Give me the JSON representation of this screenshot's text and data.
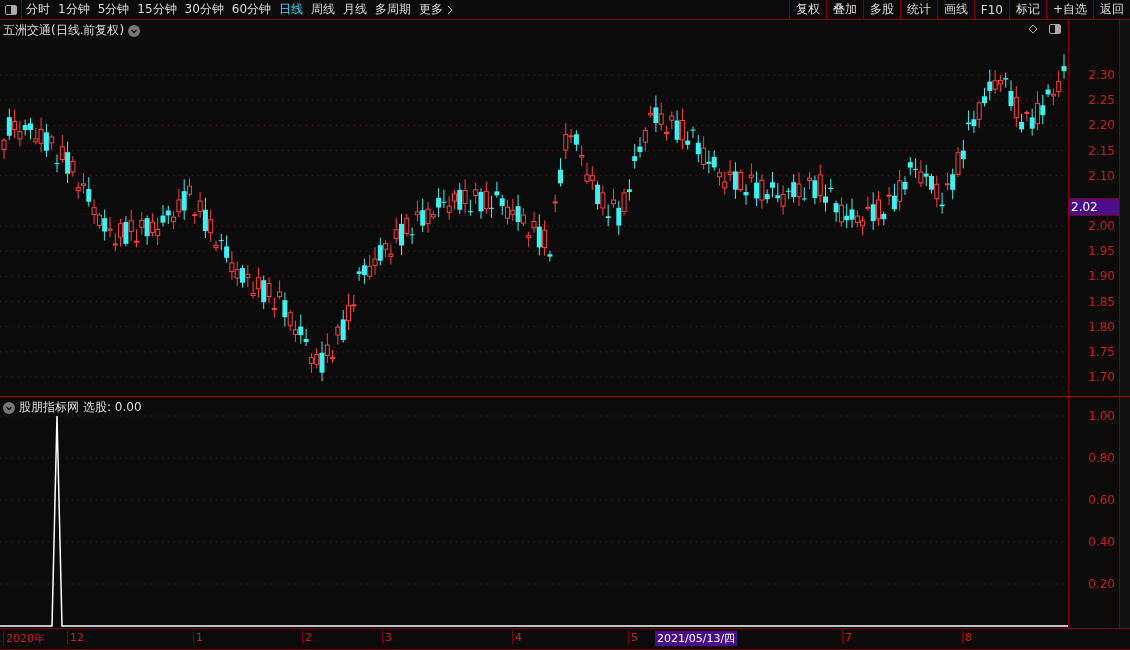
{
  "toolbar": {
    "periods": [
      {
        "label": "分时",
        "selected": false
      },
      {
        "label": "1分钟",
        "selected": false
      },
      {
        "label": "5分钟",
        "selected": false
      },
      {
        "label": "15分钟",
        "selected": false
      },
      {
        "label": "30分钟",
        "selected": false
      },
      {
        "label": "60分钟",
        "selected": false
      },
      {
        "label": "日线",
        "selected": true
      },
      {
        "label": "周线",
        "selected": false
      },
      {
        "label": "月线",
        "selected": false
      },
      {
        "label": "多周期",
        "selected": false
      },
      {
        "label": "更多",
        "selected": false
      }
    ],
    "actions": [
      "复权",
      "叠加",
      "多股",
      "统计",
      "画线",
      "F10",
      "标记",
      "+自选",
      "返回"
    ]
  },
  "main_chart": {
    "title": "五洲交通(日线.前复权)",
    "y_ticks": [
      "2.30",
      "2.25",
      "2.20",
      "2.15",
      "2.10",
      "2.00",
      "1.95",
      "1.90",
      "1.85",
      "1.80",
      "1.75",
      "1.70"
    ],
    "price_tag": "2.02"
  },
  "indicator": {
    "title": "股朋指标网",
    "reading": "选股: 0.00",
    "y_ticks": [
      "1.00",
      "0.80",
      "0.60",
      "0.40",
      "0.20"
    ]
  },
  "x_axis": {
    "labels": [
      {
        "text": "2020年",
        "selected": false
      },
      {
        "text": "12",
        "selected": false
      },
      {
        "text": "1",
        "selected": false
      },
      {
        "text": "2",
        "selected": false
      },
      {
        "text": "3",
        "selected": false
      },
      {
        "text": "4",
        "selected": false
      },
      {
        "text": "5",
        "selected": false
      },
      {
        "text": "2021/05/13/四",
        "selected": true
      },
      {
        "text": "7",
        "selected": false
      },
      {
        "text": "8",
        "selected": false
      }
    ]
  }
}
